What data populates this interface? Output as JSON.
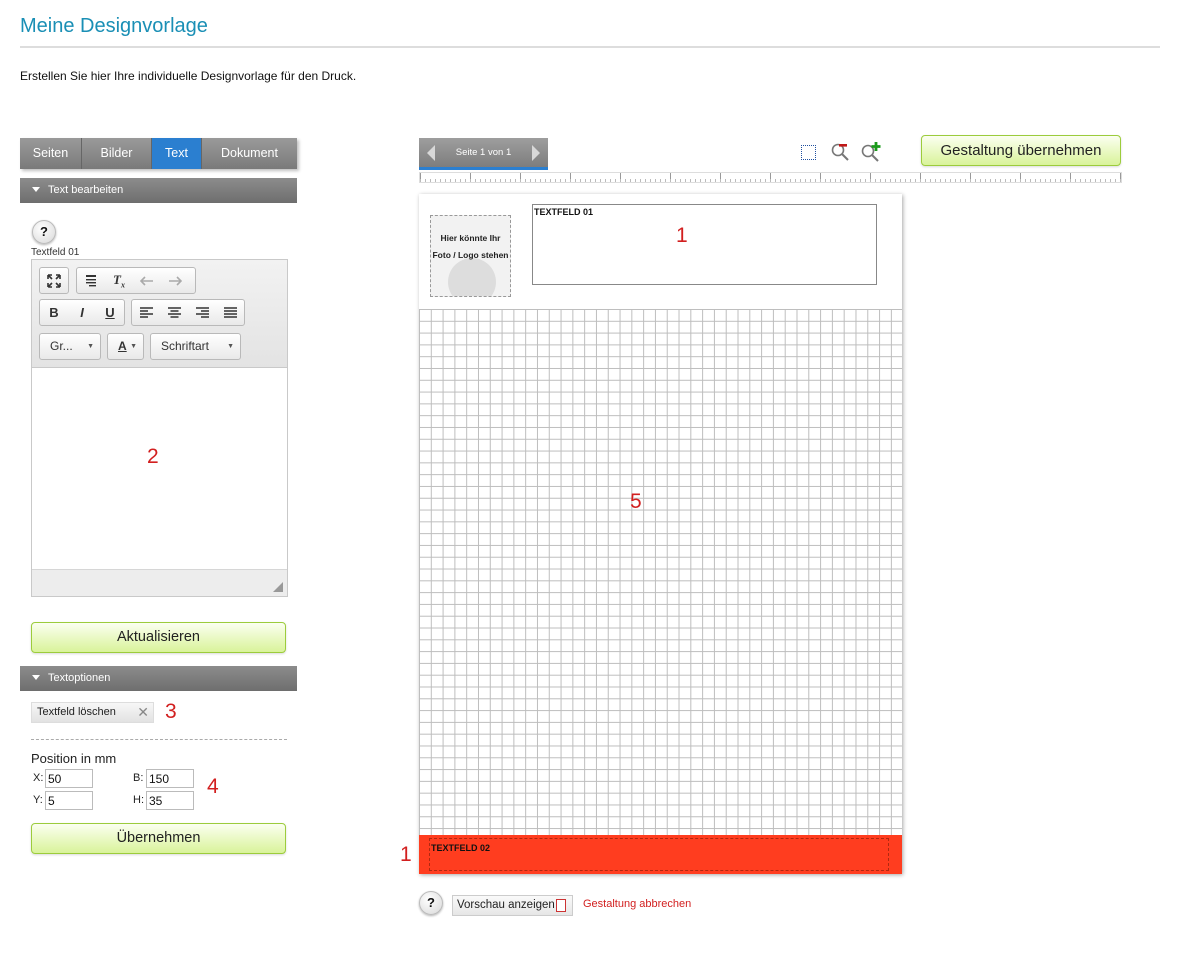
{
  "header": {
    "title": "Meine Designvorlage",
    "intro": "Erstellen Sie hier Ihre individuelle Designvorlage für den Druck."
  },
  "tabs": [
    "Seiten",
    "Bilder",
    "Text",
    "Dokument"
  ],
  "active_tab": "Text",
  "text_edit": {
    "section_label": "Text bearbeiten",
    "help": "?",
    "field_label": "Textfeld 01",
    "size_combo": "Gr...",
    "font_combo": "Schriftart",
    "color_combo": "A",
    "update_button": "Aktualisieren"
  },
  "text_options": {
    "section_label": "Textoptionen",
    "delete_button": "Textfeld löschen",
    "position_title": "Position in mm",
    "x_label": "X:",
    "x_value": "50",
    "y_label": "Y:",
    "y_value": "5",
    "b_label": "B:",
    "b_value": "150",
    "h_label": "H:",
    "h_value": "35",
    "apply_button": "Übernehmen"
  },
  "canvas": {
    "pager_label": "Seite 1 von 1",
    "apply_design_button": "Gestaltung übernehmen",
    "photo_placeholder": "Hier könnte Ihr Foto / Logo stehen",
    "textfield_1": "TEXTFELD 01",
    "textfield_2": "TEXTFELD 02",
    "footer_color": "#ff3d1f"
  },
  "footer": {
    "help": "?",
    "preview_button": "Vorschau anzeigen",
    "cancel_link": "Gestaltung abbrechen"
  },
  "annotations": {
    "a_textfield_top": "1",
    "a_editor": "2",
    "a_delete": "3",
    "a_position": "4",
    "a_grid": "5",
    "a_textfield_bottom": "1"
  },
  "icons": [
    "fullscreen-icon",
    "paste-text-icon",
    "clear-format-icon",
    "undo-icon",
    "redo-icon",
    "bold-icon",
    "italic-icon",
    "underline-icon",
    "align-left-icon",
    "align-center-icon",
    "align-right-icon",
    "justify-icon",
    "selection-icon",
    "zoom-out-icon",
    "zoom-in-icon",
    "pdf-icon",
    "close-icon"
  ]
}
